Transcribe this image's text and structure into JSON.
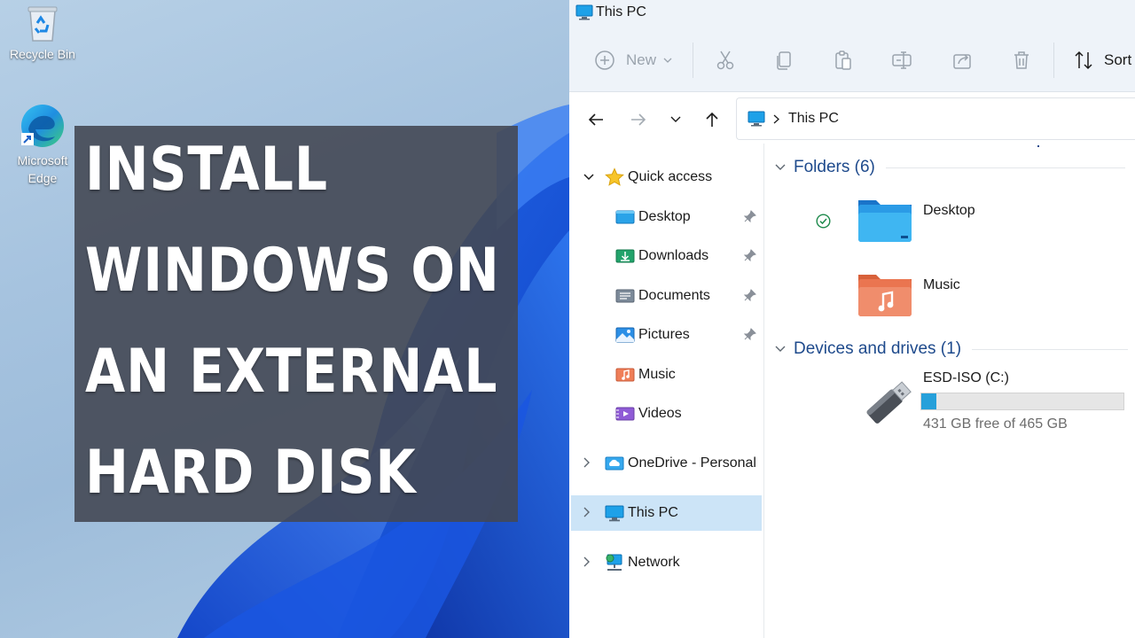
{
  "desktop": {
    "icons": [
      {
        "label": "Recycle Bin",
        "icon": "recycle-bin-icon"
      },
      {
        "label": "Microsoft Edge",
        "icon": "edge-icon"
      }
    ],
    "overlay_title_lines": [
      "INSTALL",
      "WINDOWS ON",
      "AN EXTERNAL",
      "HARD DISK"
    ]
  },
  "explorer": {
    "window_title": "This PC",
    "toolbar": {
      "new_label": "New",
      "sort_label": "Sort",
      "icons": [
        "new-icon",
        "cut-icon",
        "copy-icon",
        "paste-icon",
        "rename-icon",
        "share-icon",
        "delete-icon",
        "sort-icon"
      ]
    },
    "address": {
      "crumb": "This PC"
    },
    "sidebar": {
      "quick_access": "Quick access",
      "items": [
        {
          "label": "Desktop",
          "pinned": true
        },
        {
          "label": "Downloads",
          "pinned": true
        },
        {
          "label": "Documents",
          "pinned": true
        },
        {
          "label": "Pictures",
          "pinned": true
        },
        {
          "label": "Music",
          "pinned": false
        },
        {
          "label": "Videos",
          "pinned": false
        }
      ],
      "onedrive": "OneDrive - Personal",
      "this_pc": "This PC",
      "network": "Network"
    },
    "content": {
      "folders_header": "Folders (6)",
      "folders": [
        {
          "name": "Desktop",
          "synced": true
        },
        {
          "name": "Music",
          "synced": false
        }
      ],
      "devices_header": "Devices and drives (1)",
      "drive": {
        "name": "ESD-ISO (C:)",
        "free_text": "431 GB free of 465 GB",
        "used_fraction": 0.073
      }
    },
    "colors": {
      "accent": "#26a0da",
      "selection": "#cce4f7",
      "group_header": "#1e4a8c"
    }
  }
}
